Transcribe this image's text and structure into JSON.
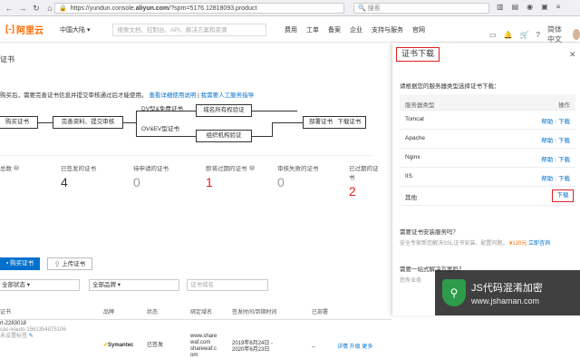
{
  "browser": {
    "url_prefix": "https://yundun.console.",
    "url_domain": "aliyun.com",
    "url_rest": "/?spm=5176.12818093.product",
    "search_placeholder": "搜索"
  },
  "topnav": {
    "logo_text": "阿里云",
    "region": "中国大陆",
    "search_placeholder": "搜索文档、控制台、API、解决方案和资源",
    "menu": [
      "费用",
      "工单",
      "备案",
      "企业",
      "支持与服务",
      "官网"
    ],
    "lang": "简体中文"
  },
  "page": {
    "title": "证书",
    "notice_text": "购买后，需要完善证书信息并提交审核通过后才能使用。",
    "notice_link1": "查看详细使用说明",
    "notice_link2": "我需要人工服务指导"
  },
  "flow": {
    "buy": "购买证书",
    "complete": "完善资料、提交审核",
    "dv_label": "DV型&免费证书",
    "ov_label": "OV&EV型证书",
    "domain_verify": "域名所有权验证",
    "org_verify": "组织机构验证",
    "deploy": "部署证书",
    "download": "下载证书"
  },
  "stats": [
    {
      "label": "总数",
      "value": "",
      "color": "#333333"
    },
    {
      "label": "已签发的证书",
      "value": "4",
      "color": "#333333"
    },
    {
      "label": "待申请的证书",
      "value": "0",
      "color": "#999999"
    },
    {
      "label": "即将过期的证书",
      "value": "1",
      "color": "#e02020"
    },
    {
      "label": "审核失败的证书",
      "value": "0",
      "color": "#999999"
    },
    {
      "label": "已过期的证书",
      "value": "2",
      "color": "#e02020"
    }
  ],
  "buttons": {
    "buy": "购买证书",
    "upload": "上传证书"
  },
  "filters": {
    "status": "全部状态",
    "brand": "全部品牌",
    "domain_placeholder": "证书域名"
  },
  "table": {
    "headers": [
      "证书",
      "品牌",
      "状态",
      "绑定域名",
      "签发时间/到期时间",
      "已部署"
    ],
    "row": {
      "cert_name": "rt-2283018",
      "cert_id": "cas-ivauto-1561354875106",
      "cert_status": "未设置标签",
      "brand": "Symantec",
      "status": "已签发",
      "domains": [
        "www.share",
        "waf.com",
        "sharewaf.c",
        "om"
      ],
      "issued": "2019年6月24日 -",
      "expires": "2020年6月23日",
      "deployed": "--",
      "actions": "详情  升级  更多"
    }
  },
  "panel": {
    "title": "证书下载",
    "desc": "请根据您的服务器类型选择证书下载：",
    "col_type": "服务器类型",
    "col_op": "操作",
    "rows": [
      {
        "type": "Tomcat",
        "help": "帮助",
        "download": "下载"
      },
      {
        "type": "Apache",
        "help": "帮助",
        "download": "下载"
      },
      {
        "type": "Nginx",
        "help": "帮助",
        "download": "下载"
      },
      {
        "type": "IIS",
        "help": "帮助",
        "download": "下载"
      },
      {
        "type": "其他",
        "help": "",
        "download": "下载"
      }
    ],
    "svc1_title": "需要证书安装服务吗？",
    "svc1_desc": "安全专家帮您解决SSL证书安装、配置问题。",
    "svc1_price": "¥120元",
    "svc1_link": "立即咨询",
    "svc2_title": "需要一站式解决方案吗？",
    "svc2_desc": "您有业务"
  },
  "watermark": {
    "line1": "JS代码混淆加密",
    "line2": "www.jshaman.com"
  }
}
